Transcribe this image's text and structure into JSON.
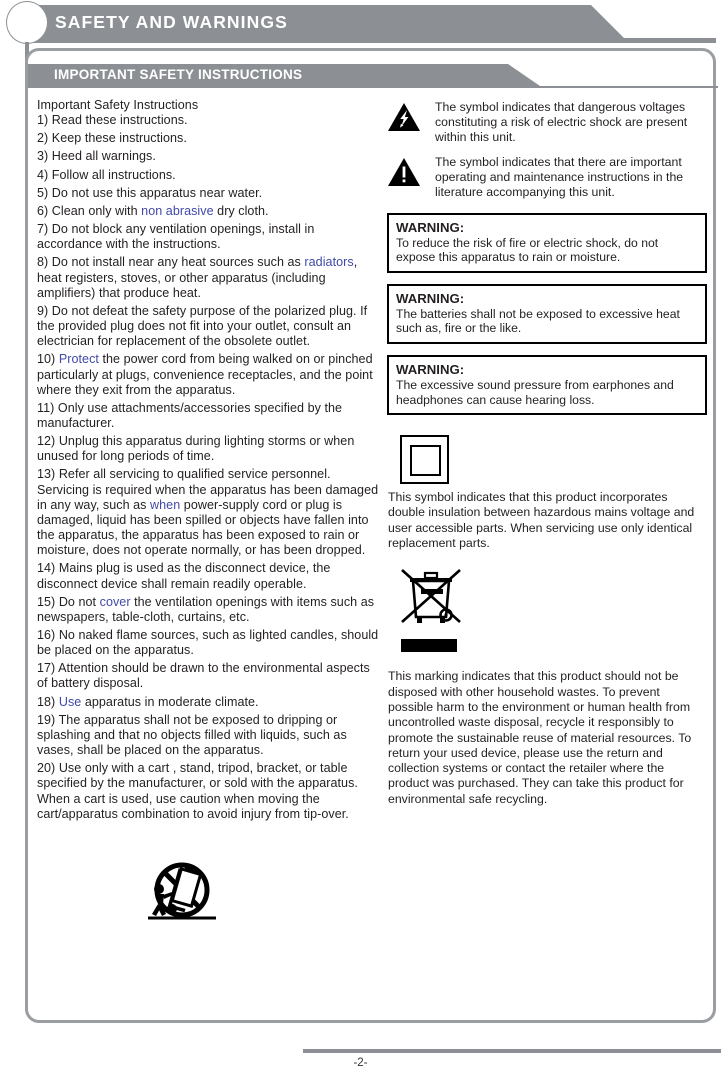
{
  "header": {
    "title": "SAFETY AND WARNINGS",
    "section_title": "IMPORTANT SAFETY INSTRUCTIONS",
    "bar_color": "#8c9094",
    "frame_color": "#9a9ea2"
  },
  "left_column": {
    "heading": "Important Safety Instructions",
    "highlight_color": "#4149a8",
    "items": [
      {
        "pre": "1) Read these instructions.",
        "hl": "",
        "post": ""
      },
      {
        "pre": "2) Keep these instructions.",
        "hl": "",
        "post": ""
      },
      {
        "pre": "3) Heed all warnings.",
        "hl": "",
        "post": ""
      },
      {
        "pre": "4) Follow all instructions.",
        "hl": "",
        "post": ""
      },
      {
        "pre": "5) Do not use this apparatus near water.",
        "hl": "",
        "post": ""
      },
      {
        "pre": "6) Clean only with ",
        "hl": "non abrasive",
        "post": " dry cloth."
      },
      {
        "pre": "7) Do not block any ventilation openings, install in accordance with the instructions.",
        "hl": "",
        "post": ""
      },
      {
        "pre": "8) Do not install near any heat sources such as ",
        "hl": "radiators",
        "post": ", heat registers, stoves, or other apparatus (including amplifiers) that produce heat."
      },
      {
        "pre": "9) Do not defeat the safety purpose of the polarized plug. If the provided plug does not fit into your outlet, consult an electrician for replacement of the obsolete outlet.",
        "hl": "",
        "post": ""
      },
      {
        "pre": "10) ",
        "hl": "Protect",
        "post": " the power cord from being walked on or pinched particularly at plugs, convenience receptacles, and the point where they exit from the apparatus."
      },
      {
        "pre": "11) Only use attachments/accessories specified by the manufacturer.",
        "hl": "",
        "post": ""
      },
      {
        "pre": "12) Unplug this apparatus during lighting storms or when unused for long periods of time.",
        "hl": "",
        "post": ""
      },
      {
        "pre": "13) Refer all servicing to qualified service personnel. Servicing is required when the apparatus has been damaged in any way, such as ",
        "hl": "when",
        "post": " power-supply cord or plug is damaged, liquid has been spilled or objects have fallen into the apparatus, the apparatus has been exposed to rain or moisture, does not operate normally, or has been dropped."
      },
      {
        "pre": "14) Mains plug is used as the disconnect device, the disconnect device shall remain readily operable.",
        "hl": "",
        "post": ""
      },
      {
        "pre": "15) Do not ",
        "hl": "cover",
        "post": " the ventilation openings with items such as newspapers, table-cloth, curtains, etc."
      },
      {
        "pre": "16) No naked flame sources, such as lighted candles, should be placed on the apparatus.",
        "hl": "",
        "post": ""
      },
      {
        "pre": "17) Attention should be drawn to the environmental aspects of battery disposal.",
        "hl": "",
        "post": ""
      },
      {
        "pre": "18) ",
        "hl": "Use",
        "post": " apparatus in moderate climate."
      },
      {
        "pre": "19) The apparatus shall not be exposed to dripping or splashing and that no objects filled with liquids, such as vases, shall be placed on the apparatus.",
        "hl": "",
        "post": ""
      },
      {
        "pre": "20) Use only with a cart , stand, tripod, bracket, or table specified by the manufacturer, or sold with the apparatus. When a cart is used, use caution when moving the cart/apparatus combination to avoid injury from tip-over.",
        "hl": "",
        "post": ""
      }
    ]
  },
  "right_column": {
    "symbols": [
      {
        "icon": "lightning-bolt-triangle-icon",
        "text": "The symbol indicates that dangerous voltages  constituting a risk of electric shock are present within this unit."
      },
      {
        "icon": "exclamation-triangle-icon",
        "text": "The symbol indicates that there  are important operating and maintenance instructions in the literature accompanying this unit."
      }
    ],
    "warnings": [
      {
        "title": "WARNING:",
        "body": "To reduce the risk of fire or electric shock, do not expose this apparatus to rain or moisture."
      },
      {
        "title": "WARNING:",
        "body": "The batteries shall not be exposed to excessive heat such as, fire or the like."
      },
      {
        "title": "WARNING:",
        "body": "The excessive sound pressure from earphones and headphones can cause hearing loss."
      }
    ],
    "double_insulation": {
      "icon": "double-insulation-square-icon",
      "text": "This symbol indicates that this product incorporates double insulation between hazardous mains voltage and user accessible parts. When servicing use only  identical replacement parts."
    },
    "weee": {
      "icon": "crossed-out-wheelie-bin-icon",
      "text": "This marking indicates that this product should not be disposed with other household wastes. To prevent possible harm to the environment or human health from uncontrolled waste disposal, recycle it responsibly to promote the sustainable reuse of material resources. To return your used device, please use the return and collection systems or contact the retailer where the product was purchased. They can take this product for environmental safe recycling."
    }
  },
  "cart_symbol": {
    "icon": "no-cart-tipover-icon"
  },
  "footer": {
    "page_number": "-2-"
  }
}
